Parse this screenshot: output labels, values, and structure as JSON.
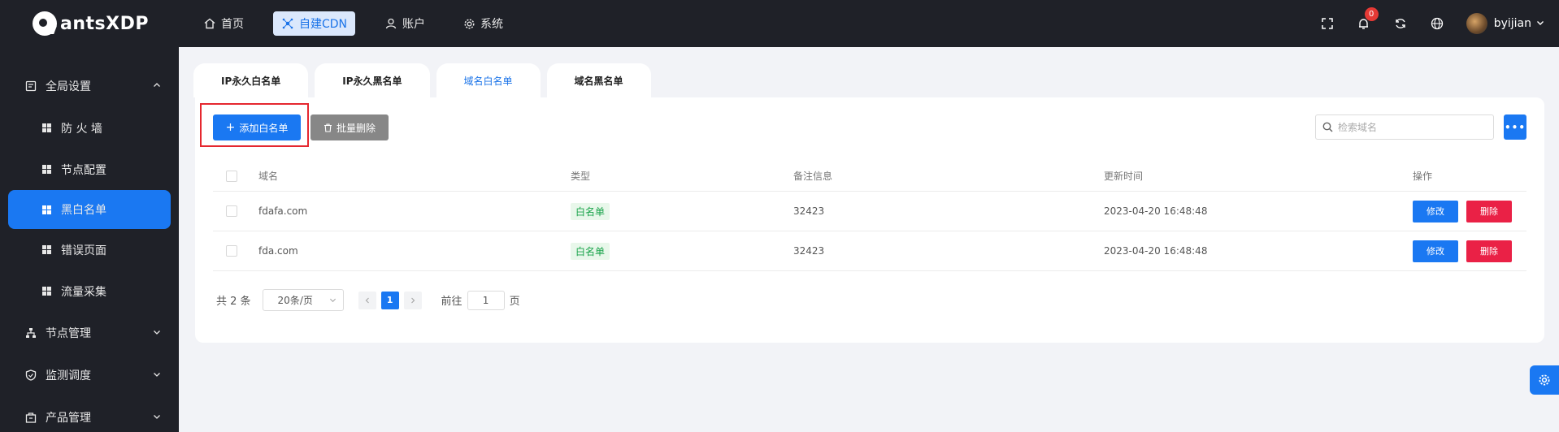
{
  "brand": {
    "name": "antsXDP"
  },
  "topnav": {
    "items": [
      {
        "label": "首页",
        "icon": "home-icon"
      },
      {
        "label": "自建CDN",
        "icon": "cdn-icon",
        "active": true
      },
      {
        "label": "账户",
        "icon": "user-icon"
      },
      {
        "label": "系统",
        "icon": "gear-icon"
      }
    ]
  },
  "topright": {
    "notifications": "0",
    "username": "byijian"
  },
  "sidebar": {
    "groups": [
      {
        "label": "全局设置",
        "expanded": true
      },
      {
        "label": "节点管理"
      },
      {
        "label": "监测调度"
      },
      {
        "label": "产品管理"
      }
    ],
    "items": [
      {
        "label": "防 火 墙"
      },
      {
        "label": "节点配置"
      },
      {
        "label": "黑白名单",
        "active": true
      },
      {
        "label": "错误页面"
      },
      {
        "label": "流量采集"
      }
    ]
  },
  "tabs": [
    {
      "label": "IP永久白名单"
    },
    {
      "label": "IP永久黑名单"
    },
    {
      "label": "域名白名单",
      "active": true
    },
    {
      "label": "域名黑名单"
    }
  ],
  "toolbar": {
    "add_label": "添加白名单",
    "batch_delete_label": "批量删除",
    "search_placeholder": "检索域名"
  },
  "table": {
    "headers": [
      "域名",
      "类型",
      "备注信息",
      "更新时间",
      "操作"
    ],
    "rows": [
      {
        "domain": "fdafa.com",
        "type": "白名单",
        "note": "32423",
        "updated": "2023-04-20 16:48:48",
        "edit": "修改",
        "delete": "删除"
      },
      {
        "domain": "fda.com",
        "type": "白名单",
        "note": "32423",
        "updated": "2023-04-20 16:48:48",
        "edit": "修改",
        "delete": "删除"
      }
    ]
  },
  "pager": {
    "total": "共 2 条",
    "page_size": "20条/页",
    "current": "1",
    "goto_label": "前往",
    "goto_value": "1",
    "page_unit": "页"
  },
  "colors": {
    "primary": "#1a78f2",
    "danger": "#ea2146",
    "dark": "#1f2128",
    "success_tag": "#19a34a"
  }
}
